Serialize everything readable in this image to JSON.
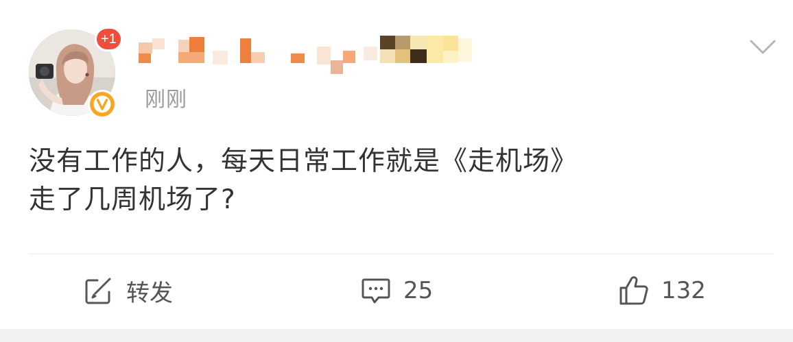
{
  "post": {
    "author": {
      "avatar_alt": "user avatar",
      "notification_badge": "+1",
      "verified_icon": "verified-v-badge-icon"
    },
    "timestamp": "刚刚",
    "body_lines": [
      "没有工作的人，每天日常工作就是《走机场》",
      "走了几周机场了?"
    ]
  },
  "actions": {
    "repost": {
      "icon": "share-icon",
      "label": "转发"
    },
    "comment": {
      "icon": "comment-icon",
      "count": "25"
    },
    "like": {
      "icon": "thumbs-up-icon",
      "count": "132"
    }
  },
  "menu": {
    "icon": "chevron-down-icon"
  },
  "colors": {
    "badge_red": "#f24c3d",
    "verified_orange": "#f6a623",
    "timestamp_gray": "#9a9a9a",
    "text": "#333333",
    "icon_gray": "#555555"
  }
}
